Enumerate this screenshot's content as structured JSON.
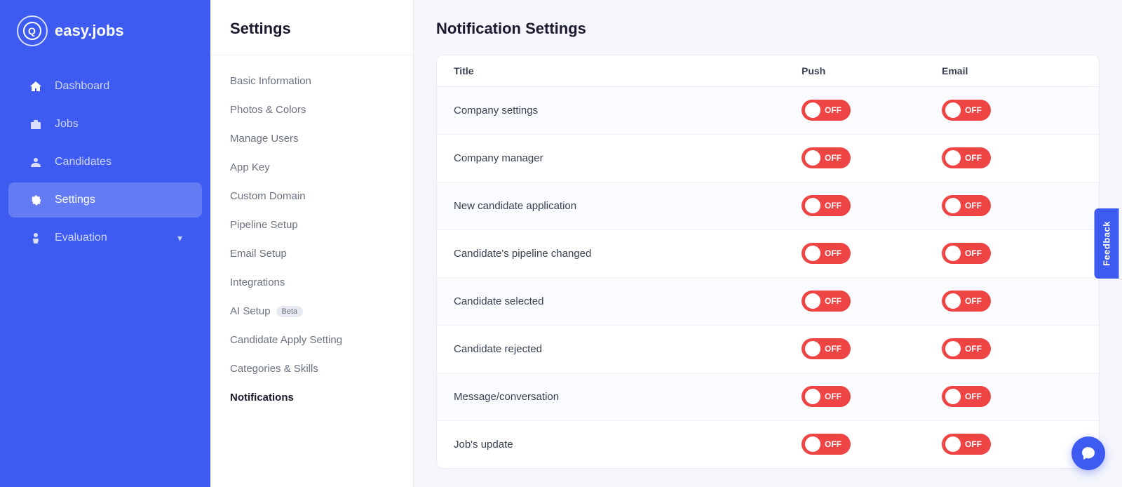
{
  "logo": {
    "icon": "Q",
    "text": "easy.jobs"
  },
  "nav": {
    "items": [
      {
        "id": "dashboard",
        "label": "Dashboard",
        "icon": "⌂",
        "active": false
      },
      {
        "id": "jobs",
        "label": "Jobs",
        "icon": "💼",
        "active": false
      },
      {
        "id": "candidates",
        "label": "Candidates",
        "icon": "👤",
        "active": false
      },
      {
        "id": "settings",
        "label": "Settings",
        "icon": "⚙",
        "active": true
      },
      {
        "id": "evaluation",
        "label": "Evaluation",
        "icon": "🎓",
        "active": false,
        "hasArrow": true
      }
    ]
  },
  "settings": {
    "title": "Settings",
    "menu": [
      {
        "id": "basic-information",
        "label": "Basic Information",
        "active": false
      },
      {
        "id": "photos-colors",
        "label": "Photos & Colors",
        "active": false
      },
      {
        "id": "manage-users",
        "label": "Manage Users",
        "active": false
      },
      {
        "id": "app-key",
        "label": "App Key",
        "active": false
      },
      {
        "id": "custom-domain",
        "label": "Custom Domain",
        "active": false
      },
      {
        "id": "pipeline-setup",
        "label": "Pipeline Setup",
        "active": false
      },
      {
        "id": "email-setup",
        "label": "Email Setup",
        "active": false
      },
      {
        "id": "integrations",
        "label": "Integrations",
        "active": false
      },
      {
        "id": "ai-setup",
        "label": "AI Setup",
        "active": false,
        "badge": "Beta"
      },
      {
        "id": "candidate-apply",
        "label": "Candidate Apply Setting",
        "active": false
      },
      {
        "id": "categories-skills",
        "label": "Categories & Skills",
        "active": false
      },
      {
        "id": "notifications",
        "label": "Notifications",
        "active": true
      }
    ]
  },
  "notifications": {
    "title": "Notification Settings",
    "table": {
      "headers": [
        "Title",
        "Push",
        "Email"
      ],
      "rows": [
        {
          "id": "company-settings",
          "title": "Company settings",
          "push": "OFF",
          "email": "OFF"
        },
        {
          "id": "company-manager",
          "title": "Company manager",
          "push": "OFF",
          "email": "OFF"
        },
        {
          "id": "new-candidate-application",
          "title": "New candidate application",
          "push": "OFF",
          "email": "OFF"
        },
        {
          "id": "candidate-pipeline-changed",
          "title": "Candidate's pipeline changed",
          "push": "OFF",
          "email": "OFF"
        },
        {
          "id": "candidate-selected",
          "title": "Candidate selected",
          "push": "OFF",
          "email": "OFF"
        },
        {
          "id": "candidate-rejected",
          "title": "Candidate rejected",
          "push": "OFF",
          "email": "OFF"
        },
        {
          "id": "message-conversation",
          "title": "Message/conversation",
          "push": "OFF",
          "email": "OFF"
        },
        {
          "id": "jobs-update",
          "title": "Job's update",
          "push": "OFF",
          "email": "OFF"
        }
      ]
    }
  },
  "feedback_label": "Feedback",
  "chat_icon": "💬"
}
